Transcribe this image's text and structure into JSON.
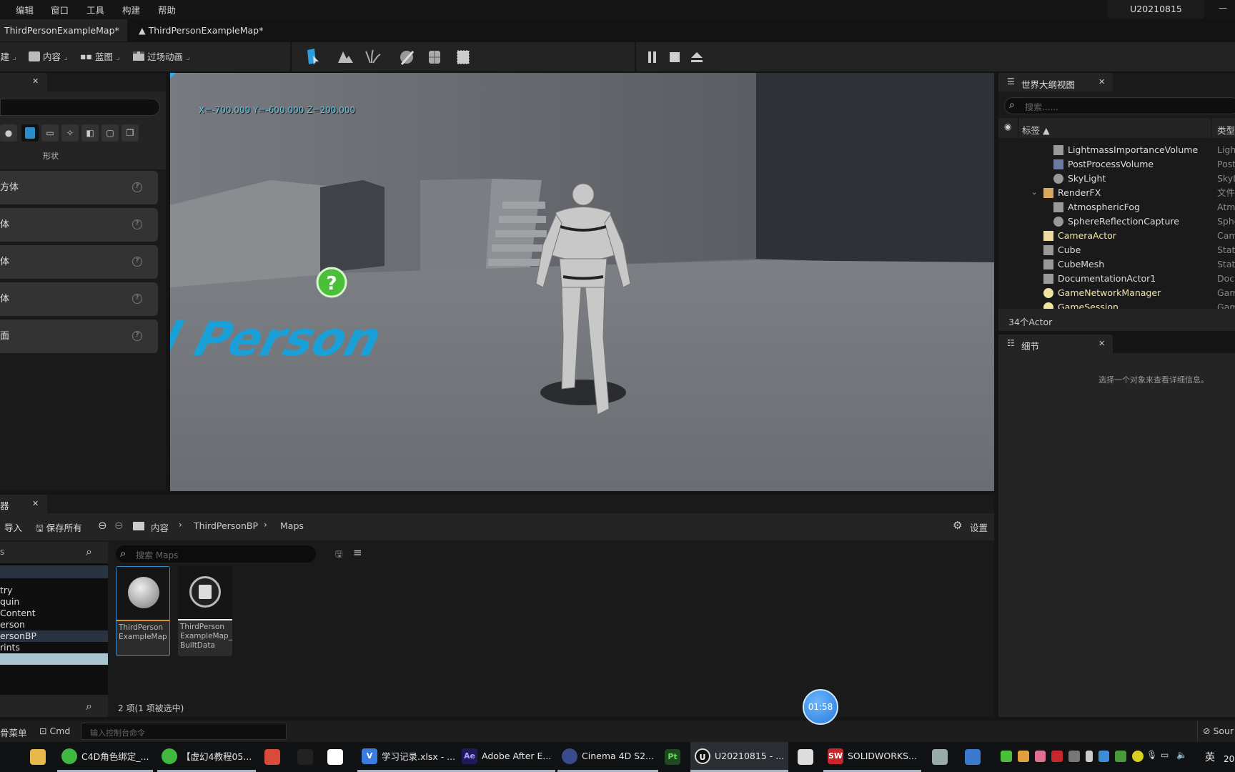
{
  "menu": [
    "编辑",
    "窗口",
    "工具",
    "构建",
    "帮助"
  ],
  "project_name": "U20210815",
  "tabs": [
    {
      "label": "ThirdPersonExampleMap*",
      "active": true
    },
    {
      "label": "ThirdPersonExampleMap*",
      "active": false
    }
  ],
  "toolbar": {
    "build_label": "构建",
    "content_label": "内容",
    "blueprint_label": "蓝图",
    "cinematics_label": "过场动画",
    "mode_icons": [
      "select-mode-icon",
      "landscape-icon",
      "foliage-icon",
      "mesh-paint-icon",
      "fracture-icon",
      "brush-edit-icon"
    ],
    "play_icons": [
      "pause-icon",
      "stop-icon",
      "eject-icon"
    ]
  },
  "place_actors": {
    "category_label": "形状",
    "items": [
      "立方体",
      "球体",
      "圆柱体",
      "锥体",
      "平面"
    ]
  },
  "viewport": {
    "coords": "X=-700.000 Y=-600.000 Z=200.000",
    "floor_text": "d Person"
  },
  "outliner": {
    "title": "世界大纲视图",
    "search_placeholder": "搜索......",
    "col_label": "标签 ▲",
    "col_type": "类型",
    "rows": [
      {
        "name": "LightmassImportanceVolume",
        "type": "LightmassImportanceVolume",
        "level": 2,
        "icon": "lightmass-volume-icon"
      },
      {
        "name": "PostProcessVolume",
        "type": "PostProcessVolume",
        "level": 2,
        "icon": "postprocess-volume-icon"
      },
      {
        "name": "SkyLight",
        "type": "SkyLight",
        "level": 2,
        "icon": "skylight-icon"
      },
      {
        "name": "RenderFX",
        "type": "文件夹",
        "level": 1,
        "icon": "folder-open-icon"
      },
      {
        "name": "AtmosphericFog",
        "type": "AtmosphericFog",
        "level": 2,
        "icon": "fog-icon"
      },
      {
        "name": "SphereReflectionCapture",
        "type": "SphereReflectionCapture",
        "level": 2,
        "icon": "reflection-capture-icon"
      },
      {
        "name": "CameraActor",
        "type": "CameraActor",
        "level": 1,
        "icon": "camera-icon"
      },
      {
        "name": "Cube",
        "type": "StaticMeshActor",
        "level": 1,
        "icon": "static-mesh-icon"
      },
      {
        "name": "CubeMesh",
        "type": "StaticMeshActor",
        "level": 1,
        "icon": "static-mesh-icon"
      },
      {
        "name": "DocumentationActor1",
        "type": "DocumentationActor",
        "level": 1,
        "icon": "documentation-icon"
      },
      {
        "name": "GameNetworkManager",
        "type": "GameNetworkManager",
        "level": 1,
        "icon": "actor-sphere-icon"
      },
      {
        "name": "GameSession",
        "type": "GameSession",
        "level": 1,
        "icon": "actor-sphere-icon"
      }
    ],
    "actor_count": "34个Actor"
  },
  "details": {
    "title": "细节",
    "empty_message": "选择一个对象来查看详细信息。"
  },
  "content_browser": {
    "tab_label": "器",
    "import_label": "导入",
    "save_all_label": "保存所有",
    "breadcrumb": [
      "内容",
      "ThirdPersonBP",
      "Maps"
    ],
    "settings_label": "设置",
    "source_search_placeholder": "s",
    "folders": [
      "try",
      "quin",
      "Content",
      "erson",
      "ersonBP",
      "rints",
      ""
    ],
    "asset_search_placeholder": "搜索 Maps",
    "assets": [
      {
        "line1": "ThirdPerson",
        "line2": "ExampleMap",
        "line3": "",
        "selected": true,
        "color": "#d9902a"
      },
      {
        "line1": "ThirdPerson",
        "line2": "ExampleMap_",
        "line3": "BuiltData",
        "selected": false,
        "color": "#e8e8e8"
      }
    ],
    "status": "2 项(1 项被选中)"
  },
  "console": {
    "menu_label": "骨菜单",
    "cmd_label": "Cmd",
    "placeholder": "输入控制台命令",
    "source_label": "Sour"
  },
  "timer": "01:58",
  "taskbar": {
    "items": [
      {
        "label": "",
        "icon": "file-explorer-icon",
        "color": "#e8b84a"
      },
      {
        "label": "C4D角色绑定_...",
        "icon": "browser-icon",
        "color": "#3fb93f"
      },
      {
        "label": "【虚幻4教程05...",
        "icon": "browser-icon",
        "color": "#3fb93f"
      },
      {
        "label": "",
        "icon": "app-icon",
        "color": "#d94a3a"
      },
      {
        "label": "",
        "icon": "qq-icon",
        "color": "#222"
      },
      {
        "label": "",
        "icon": "baidu-netdisk-icon",
        "color": "#ffffff"
      },
      {
        "label": "学习记录.xlsx - ...",
        "icon": "wps-icon",
        "color": "#3a7be0"
      },
      {
        "label": "Adobe After E...",
        "icon": "after-effects-icon",
        "color": "#1f1a5a"
      },
      {
        "label": "Cinema 4D S2...",
        "icon": "cinema4d-icon",
        "color": "#3a4a8a"
      },
      {
        "label": "",
        "icon": "painter-icon",
        "color": "#1f4a1f"
      },
      {
        "label": "U20210815 - ...",
        "icon": "unreal-icon",
        "color": "#111"
      },
      {
        "label": "",
        "icon": "zbrush-icon",
        "color": "#ddd"
      },
      {
        "label": "SOLIDWORKS...",
        "icon": "solidworks-icon",
        "color": "#c8262b"
      },
      {
        "label": "",
        "icon": "monitor-icon",
        "color": "#9aa"
      },
      {
        "label": "",
        "icon": "window-icon",
        "color": "#3a7bd0"
      }
    ],
    "ime": "英",
    "clock": "20"
  }
}
